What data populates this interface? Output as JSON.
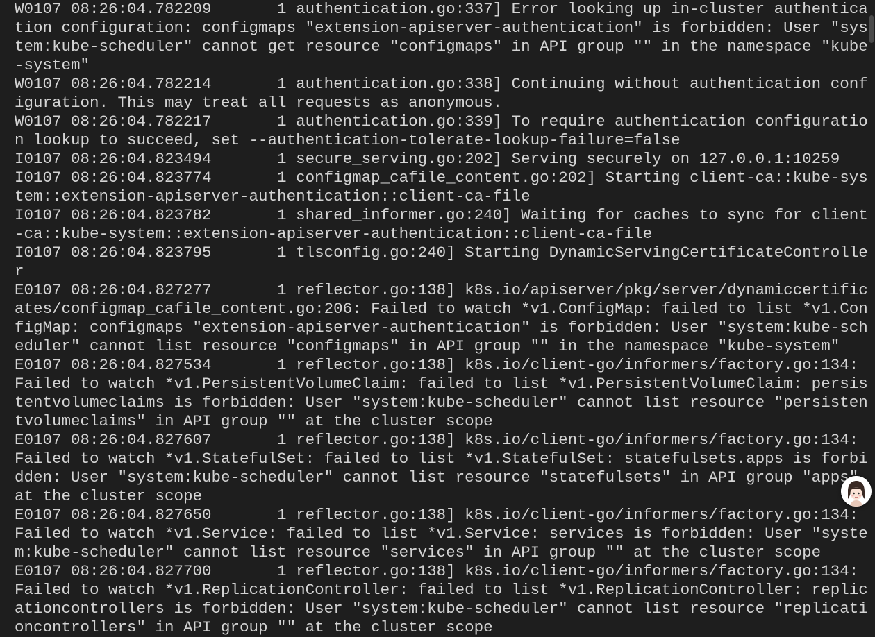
{
  "terminal": {
    "lines": [
      "W0107 08:26:04.782209       1 authentication.go:337] Error looking up in-cluster authentica",
      "tion configuration: configmaps \"extension-apiserver-authentication\" is forbidden: User \"sys",
      "tem:kube-scheduler\" cannot get resource \"configmaps\" in API group \"\" in the namespace \"kube",
      "-system\"",
      "W0107 08:26:04.782214       1 authentication.go:338] Continuing without authentication conf",
      "iguration. This may treat all requests as anonymous.",
      "W0107 08:26:04.782217       1 authentication.go:339] To require authentication configuratio",
      "n lookup to succeed, set --authentication-tolerate-lookup-failure=false",
      "I0107 08:26:04.823494       1 secure_serving.go:202] Serving securely on 127.0.0.1:10259",
      "I0107 08:26:04.823774       1 configmap_cafile_content.go:202] Starting client-ca::kube-sys",
      "tem::extension-apiserver-authentication::client-ca-file",
      "I0107 08:26:04.823782       1 shared_informer.go:240] Waiting for caches to sync for client",
      "-ca::kube-system::extension-apiserver-authentication::client-ca-file",
      "I0107 08:26:04.823795       1 tlsconfig.go:240] Starting DynamicServingCertificateControlle",
      "r",
      "E0107 08:26:04.827277       1 reflector.go:138] k8s.io/apiserver/pkg/server/dynamiccertific",
      "ates/configmap_cafile_content.go:206: Failed to watch *v1.ConfigMap: failed to list *v1.Con",
      "figMap: configmaps \"extension-apiserver-authentication\" is forbidden: User \"system:kube-sch",
      "eduler\" cannot list resource \"configmaps\" in API group \"\" in the namespace \"kube-system\"",
      "E0107 08:26:04.827534       1 reflector.go:138] k8s.io/client-go/informers/factory.go:134:",
      "Failed to watch *v1.PersistentVolumeClaim: failed to list *v1.PersistentVolumeClaim: persis",
      "tentvolumeclaims is forbidden: User \"system:kube-scheduler\" cannot list resource \"persisten",
      "tvolumeclaims\" in API group \"\" at the cluster scope",
      "E0107 08:26:04.827607       1 reflector.go:138] k8s.io/client-go/informers/factory.go:134:",
      "Failed to watch *v1.StatefulSet: failed to list *v1.StatefulSet: statefulsets.apps is forbi",
      "dden: User \"system:kube-scheduler\" cannot list resource \"statefulsets\" in API group \"apps\"",
      "at the cluster scope",
      "E0107 08:26:04.827650       1 reflector.go:138] k8s.io/client-go/informers/factory.go:134:",
      "Failed to watch *v1.Service: failed to list *v1.Service: services is forbidden: User \"syste",
      "m:kube-scheduler\" cannot list resource \"services\" in API group \"\" at the cluster scope",
      "E0107 08:26:04.827700       1 reflector.go:138] k8s.io/client-go/informers/factory.go:134:",
      "Failed to watch *v1.ReplicationController: failed to list *v1.ReplicationController: replic",
      "ationcontrollers is forbidden: User \"system:kube-scheduler\" cannot list resource \"replicati",
      "oncontrollers\" in API group \"\" at the cluster scope"
    ]
  },
  "colors": {
    "background": "#1e1e1e",
    "text": "#d4d4d4"
  },
  "assistant": {
    "icon": "avatar-icon"
  }
}
